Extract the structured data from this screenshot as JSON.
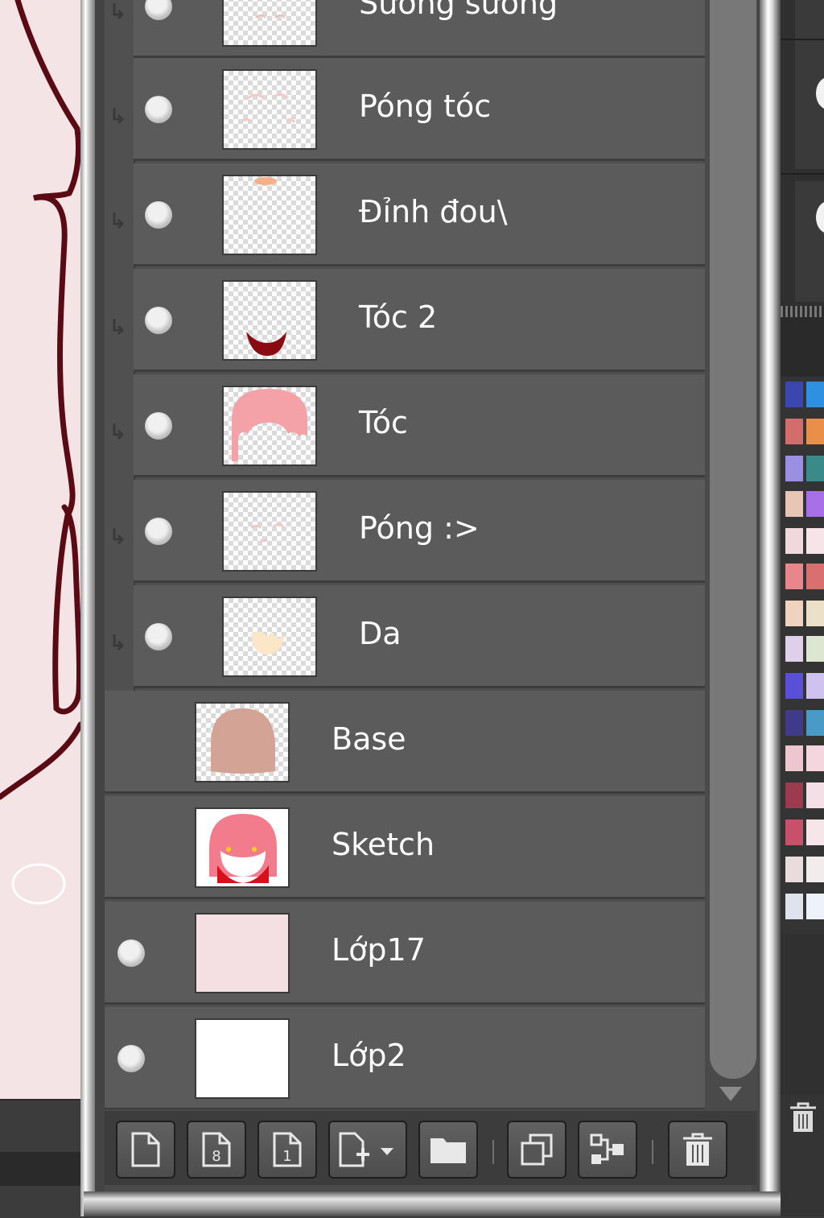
{
  "layers_panel": {
    "layers": [
      {
        "name": "Sương sương",
        "clipped": true,
        "visible": true
      },
      {
        "name": "Póng tóc",
        "clipped": true,
        "visible": true
      },
      {
        "name": "Đỉnh đou\\",
        "clipped": true,
        "visible": true
      },
      {
        "name": "Tóc 2",
        "clipped": true,
        "visible": true
      },
      {
        "name": "Tóc",
        "clipped": true,
        "visible": true
      },
      {
        "name": "Póng :>",
        "clipped": true,
        "visible": true
      },
      {
        "name": "Da",
        "clipped": true,
        "visible": true
      },
      {
        "name": "Base",
        "clipped": false,
        "visible": false
      },
      {
        "name": "Sketch",
        "clipped": false,
        "visible": false
      },
      {
        "name": "Lớp17",
        "clipped": false,
        "visible": true
      },
      {
        "name": "Lớp2",
        "clipped": false,
        "visible": true
      }
    ]
  },
  "toolbar": {
    "buttons": [
      "new-layer-icon",
      "new-8bit-layer-icon",
      "new-1bit-layer-icon",
      "add-layer-menu-icon",
      "new-folder-icon",
      "duplicate-layer-icon",
      "merge-layer-icon",
      "delete-layer-icon"
    ]
  },
  "colors": {
    "panel_bg": "#4a4a4a",
    "row_bg": "#5b5b5b",
    "canvas_bg": "#f4e4e6",
    "text": "#ffffff"
  }
}
